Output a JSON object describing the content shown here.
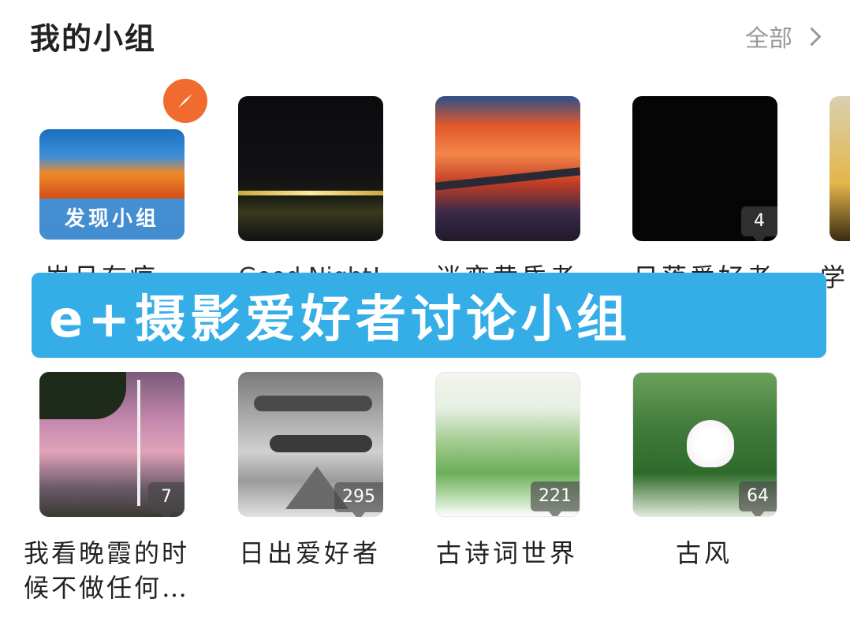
{
  "header": {
    "title": "我的小组",
    "view_all_label": "全部"
  },
  "banner": {
    "text": "e+摄影爱好者讨论小组"
  },
  "row1": [
    {
      "name": "岁月有痕",
      "label": "发现小组",
      "badge": ""
    },
    {
      "name": "Good Night!",
      "badge": ""
    },
    {
      "name": "迷恋黄昏者",
      "badge": ""
    },
    {
      "name": "日落爱好者",
      "badge": "4"
    },
    {
      "name": "学…",
      "badge": ""
    }
  ],
  "row2": [
    {
      "name": "我看晚霞的时候不做任何…",
      "line1": "我看晚霞的时",
      "line2": "候不做任何…",
      "badge": "7"
    },
    {
      "name": "日出爱好者",
      "badge": "295"
    },
    {
      "name": "古诗词世界",
      "badge": "221"
    },
    {
      "name": "古风",
      "badge": "64"
    }
  ],
  "colors": {
    "accent_orange": "#f26b2e",
    "banner_blue": "#35aee8",
    "badge_bg": "#555555"
  }
}
